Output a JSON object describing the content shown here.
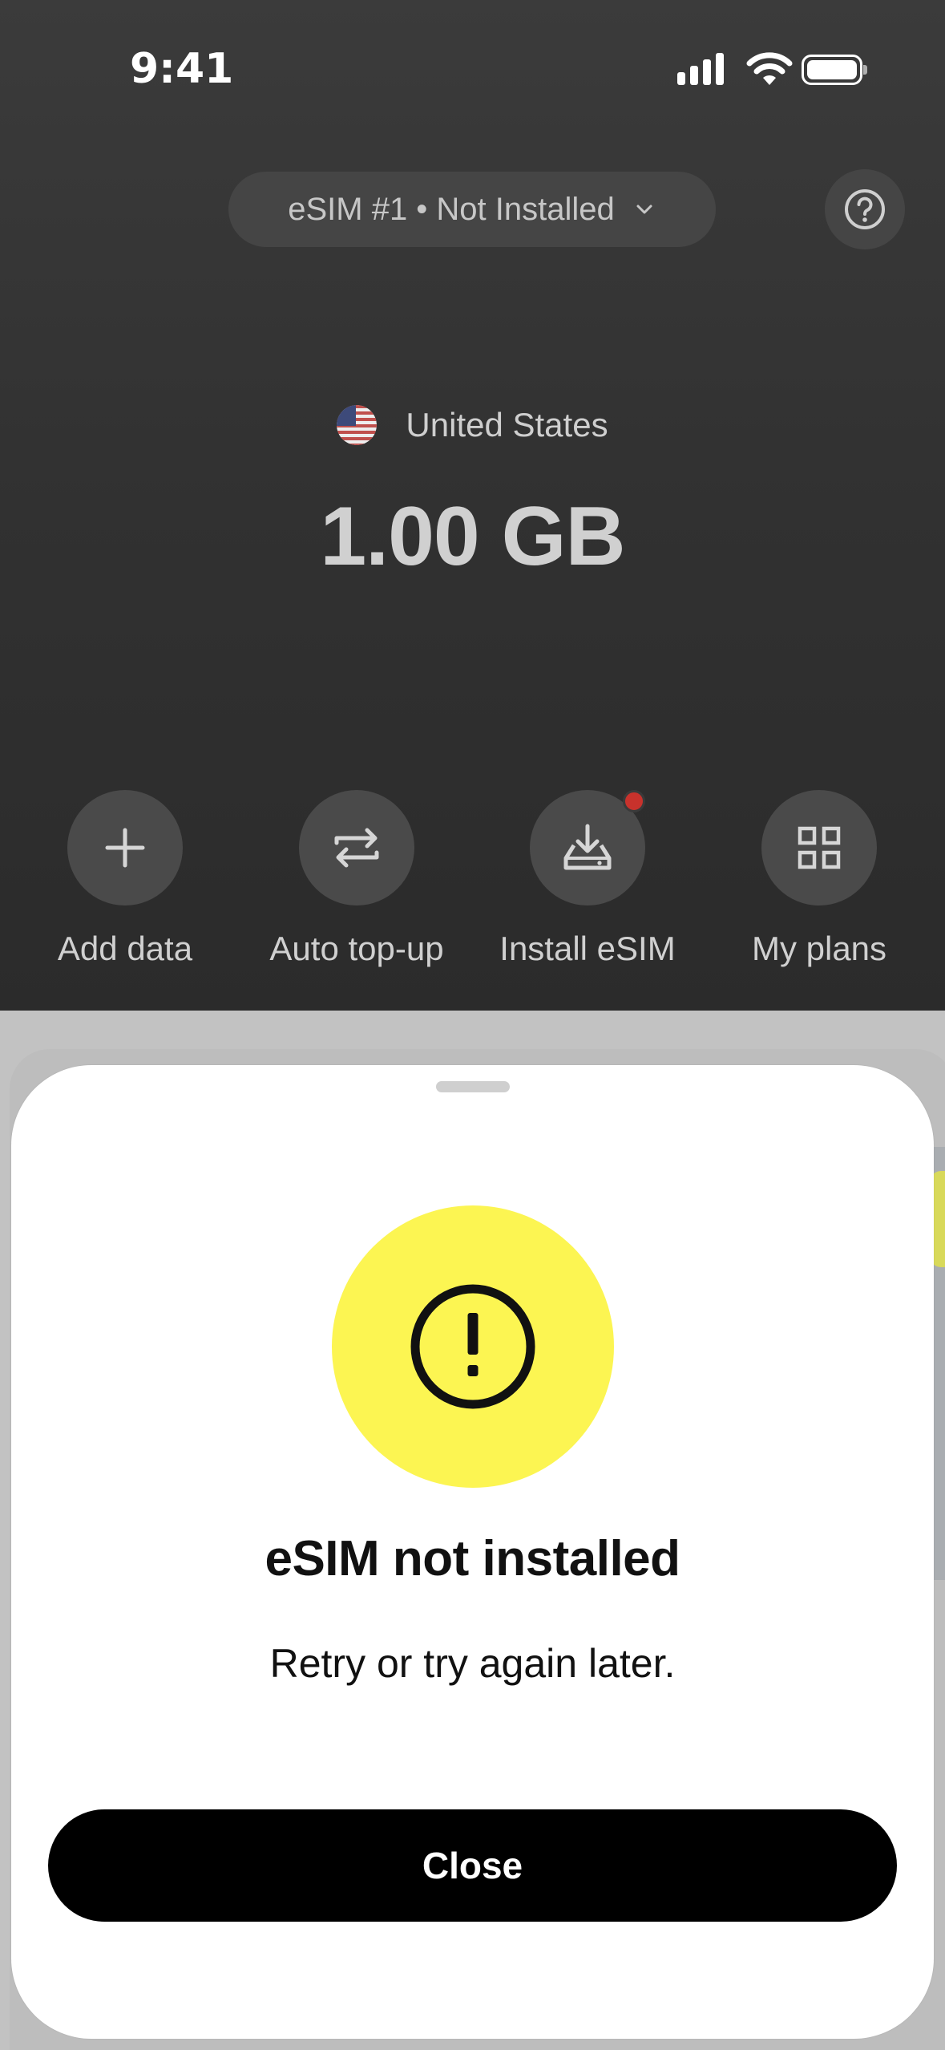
{
  "status_bar": {
    "time": "9:41"
  },
  "header": {
    "esim_selector": "eSIM #1 • Not Installed",
    "help_icon": "question-circle-icon"
  },
  "plan": {
    "country": "United States",
    "flag_icon": "us-flag-icon",
    "data_amount": "1.00 GB"
  },
  "actions": [
    {
      "label": "Add data",
      "icon": "plus-icon"
    },
    {
      "label": "Auto top-up",
      "icon": "repeat-arrows-icon"
    },
    {
      "label": "Install eSIM",
      "icon": "download-tray-icon",
      "badge": true
    },
    {
      "label": "My plans",
      "icon": "grid-icon"
    }
  ],
  "sheet": {
    "icon": "exclamation-circle-icon",
    "title": "eSIM not installed",
    "message": "Retry or try again later.",
    "close_label": "Close"
  },
  "colors": {
    "background_dark": "#313131",
    "action_circle": "#4a4a4a",
    "warning_yellow": "#fcf552",
    "badge_red": "#c8322c",
    "button_black": "#000000"
  }
}
